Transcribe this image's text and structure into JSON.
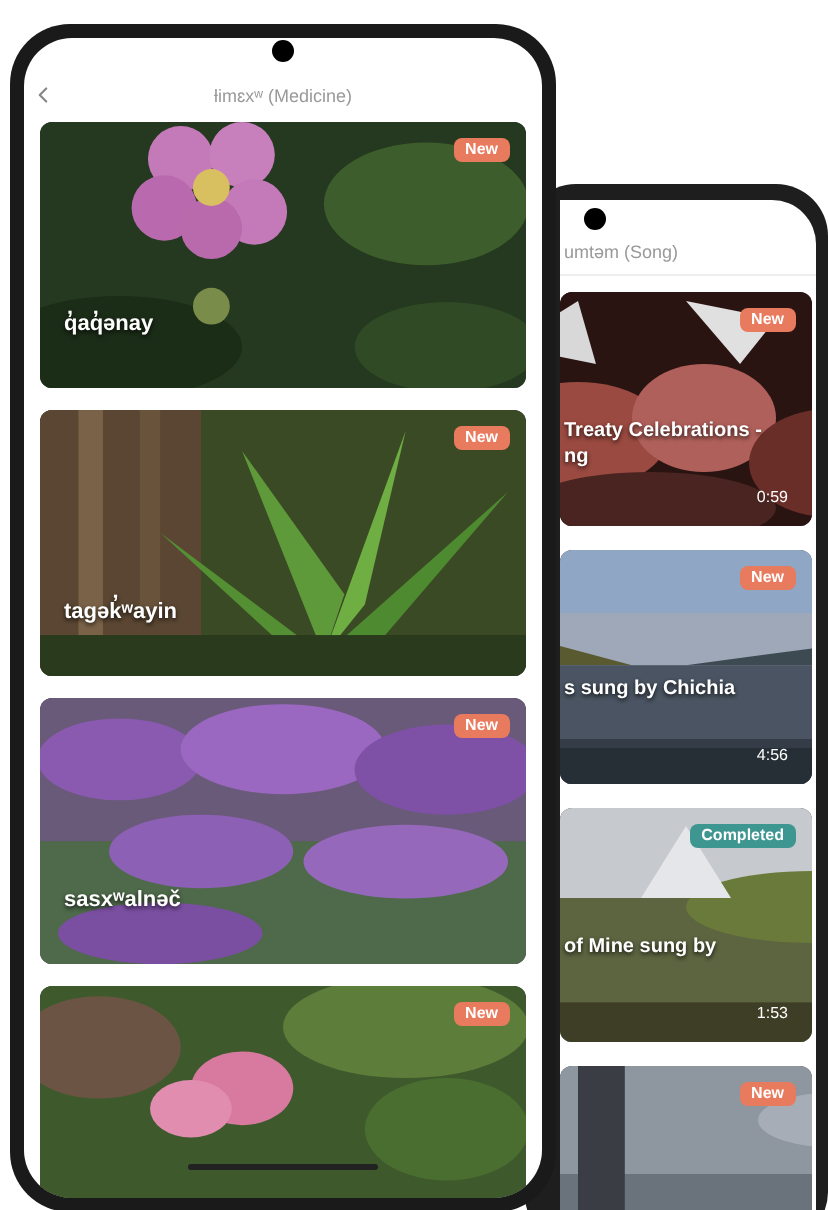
{
  "phones": [
    {
      "title": "ƚimɛxʷ (Medicine)",
      "cards": [
        {
          "lines": [
            "q̓aq̓ənay"
          ],
          "badge": {
            "text": "New",
            "kind": "new"
          }
        },
        {
          "lines": [
            "tagək̓ʷayin"
          ],
          "badge": {
            "text": "New",
            "kind": "new"
          }
        },
        {
          "lines": [
            "sasxʷalnəč"
          ],
          "badge": {
            "text": "New",
            "kind": "new"
          }
        },
        {
          "badge": {
            "text": "New",
            "kind": "new"
          }
        }
      ]
    },
    {
      "title": "umtəm (Song)",
      "cards": [
        {
          "lines": [
            "Treaty Celebrations -",
            "ng"
          ],
          "duration": "0:59",
          "badge": {
            "text": "New",
            "kind": "new"
          }
        },
        {
          "lines": [
            "s sung by Chichia"
          ],
          "duration": "4:56",
          "badge": {
            "text": "New",
            "kind": "new"
          }
        },
        {
          "lines": [
            "of Mine sung by"
          ],
          "duration": "1:53",
          "badge": {
            "text": "Completed",
            "kind": "completed"
          }
        },
        {
          "badge": {
            "text": "New",
            "kind": "new"
          }
        }
      ]
    }
  ]
}
